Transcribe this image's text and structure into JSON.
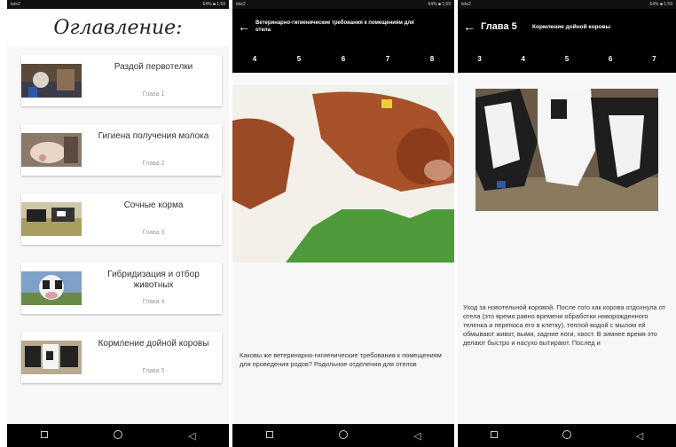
{
  "status": {
    "left": "tele2",
    "right": "64% ■ 1:59"
  },
  "contents": {
    "title": "Оглавление:",
    "items": [
      {
        "title": "Раздой первотелки",
        "subtitle": "Глава 1"
      },
      {
        "title": "Гигиена получения молока",
        "subtitle": "Глава 2"
      },
      {
        "title": "Сочные корма",
        "subtitle": "Глава 3"
      },
      {
        "title": "Гибридизация и отбор животных",
        "subtitle": "Глава 4"
      },
      {
        "title": "Кормление дойной коровы",
        "subtitle": "Глава 5"
      }
    ]
  },
  "chapter_view": {
    "back": "←",
    "title": "Ветеринарно-гигиенические требования к помещениям для отела",
    "tabs": [
      "4",
      "5",
      "6",
      "7",
      "8"
    ],
    "body": "Каковы же ветеринарно-гигиенические требования к помещениям для проведения родов? Родильное отделения для отелов"
  },
  "chapter5": {
    "back": "←",
    "chapter_label": "Глава 5",
    "title": "Кормление дойной коровы",
    "tabs": [
      "3",
      "4",
      "5",
      "6",
      "7"
    ],
    "body": "Уход за новотельной коровой. После того как корова отдохнула от отела (это время равно времени обработки новорожденного теленка и переноса его в клетку), теплой водой с мылом ей обмывают живот, вымя, задние ноги, хвост. В зимнее время это делают быстро и насухо вытирают. Послед и"
  },
  "navbar": {
    "back": "◁"
  }
}
